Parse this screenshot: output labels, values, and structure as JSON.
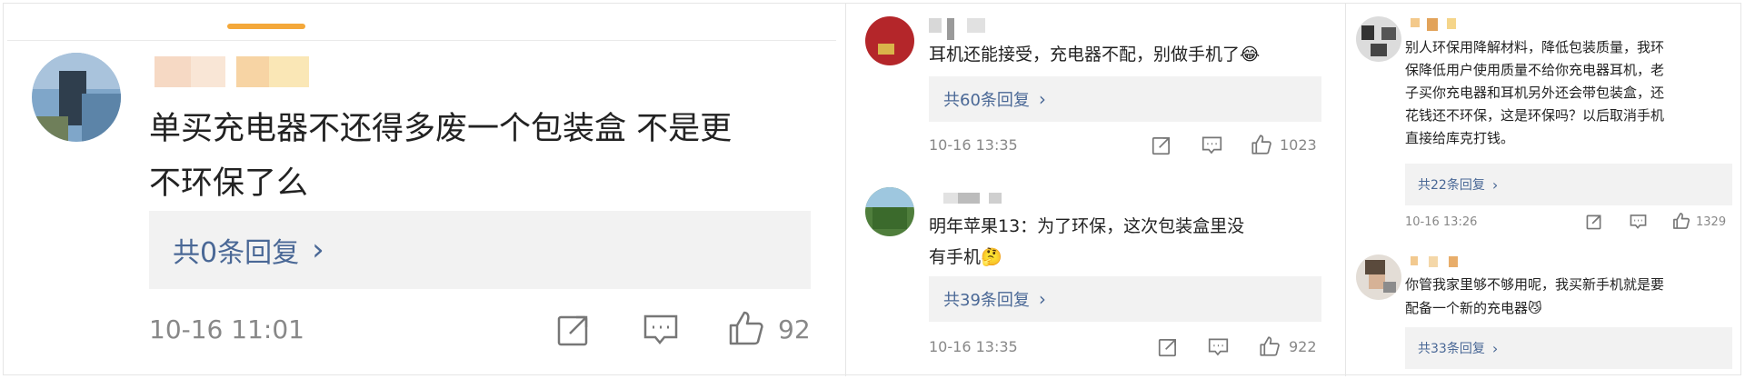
{
  "comments": [
    {
      "text": "单买充电器不还得多废一个包装盒 不是更\n不环保了么",
      "replies": "共0条回复",
      "time": "10-16 11:01",
      "likes": "92"
    },
    {
      "text": "耳机还能接受，充电器不配，别做手机了😂",
      "replies": "共60条回复",
      "time": "10-16 13:35",
      "likes": "1023"
    },
    {
      "text": "明年苹果13：为了环保，这次包装盒里没\n有手机🤔",
      "replies": "共39条回复",
      "time": "10-16 13:35",
      "likes": "922"
    },
    {
      "text": "别人环保用降解材料，降低包装质量，我环\n保降低用户使用质量不给你充电器耳机，老\n子买你充电器和耳机另外还会带包装盒，还\n花钱还不环保，这是环保吗？以后取消手机\n直接给库克打钱。",
      "replies": "共22条回复",
      "time": "10-16 13:26",
      "likes": "1329"
    },
    {
      "text": "你管我家里够不够用呢，我买新手机就是要\n配备一个新的充电器😼",
      "replies": "共33条回复"
    }
  ],
  "chevron": "›",
  "icons": [
    "share-icon",
    "comment-icon",
    "like-icon"
  ],
  "colors": {
    "accent": "#f4a83a",
    "link": "#4a6896",
    "meta": "#888888",
    "reply_bg": "#f2f2f2"
  }
}
